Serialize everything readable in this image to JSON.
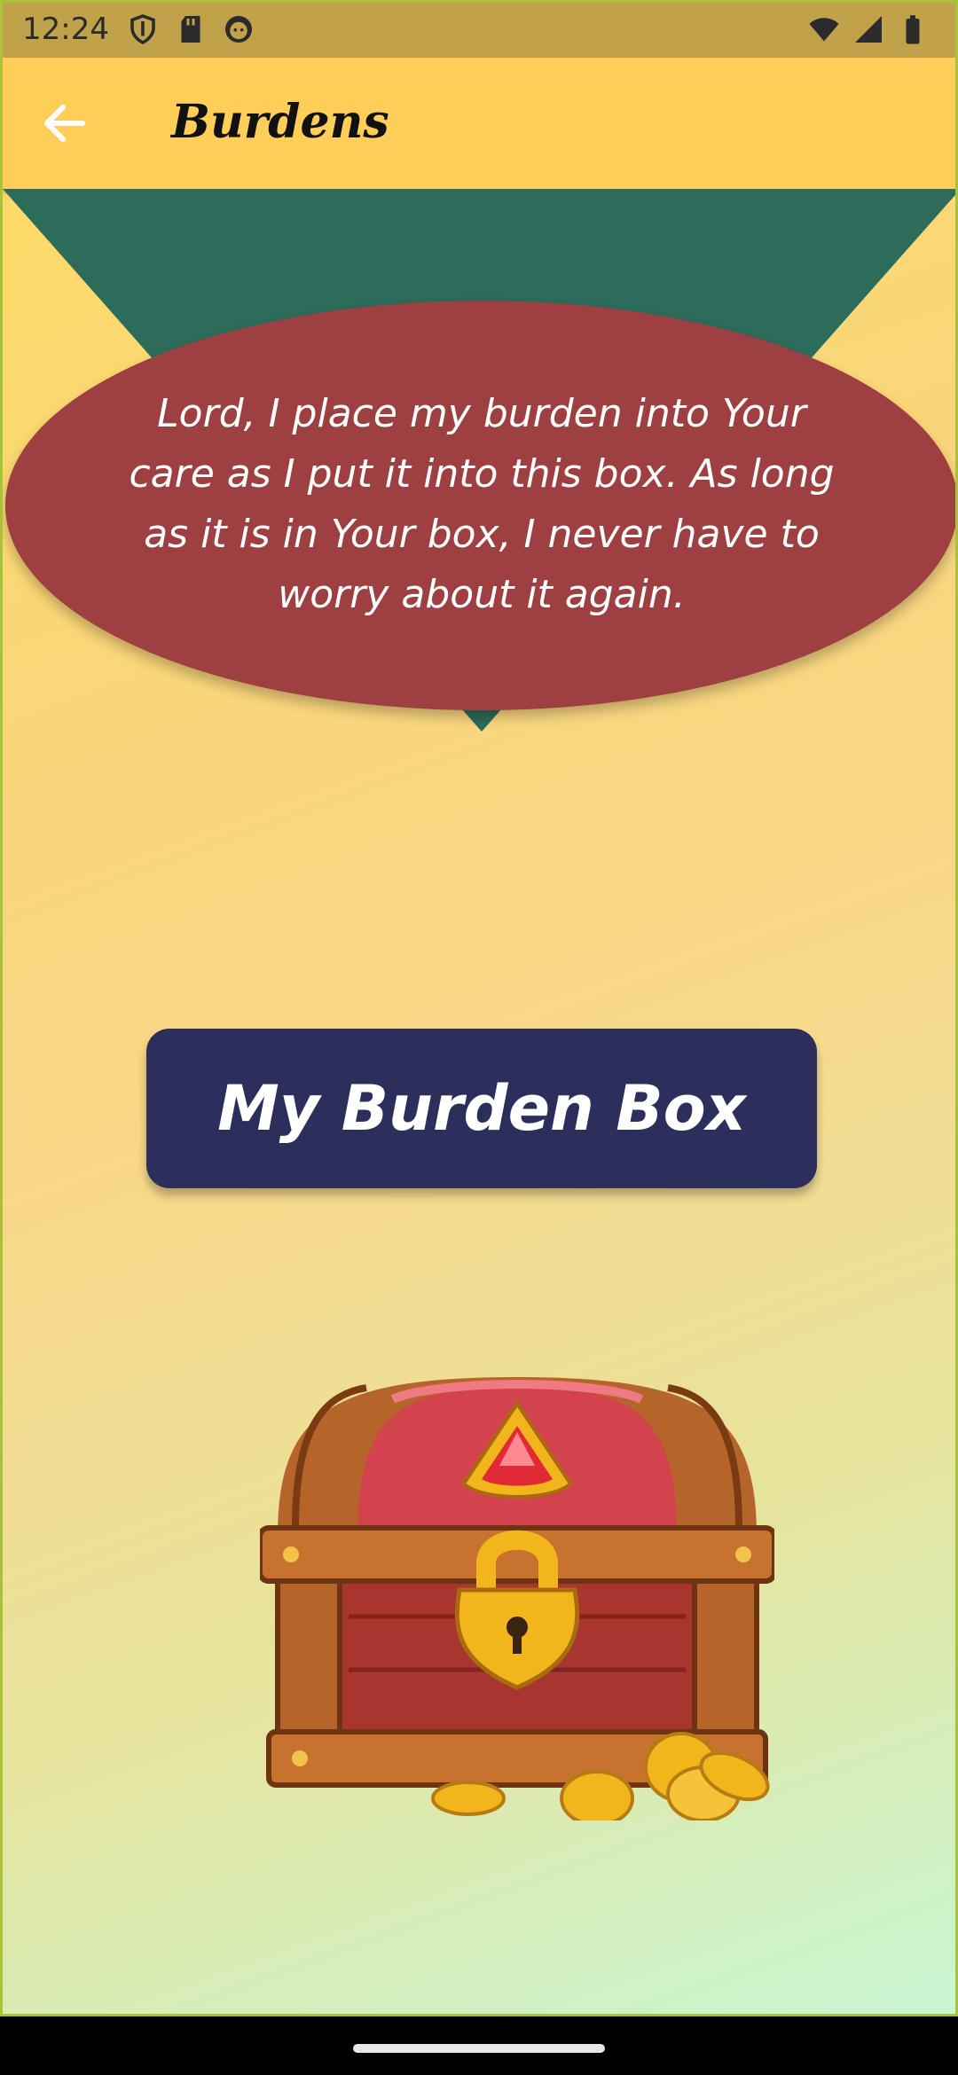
{
  "status_bar": {
    "time": "12:24",
    "left_icons": [
      "shield-icon",
      "sd-card-icon",
      "face-icon"
    ],
    "right_icons": [
      "wifi-icon",
      "signal-icon",
      "battery-icon"
    ]
  },
  "app_bar": {
    "title": "Burdens",
    "back_icon": "arrow-back-icon"
  },
  "prayer": {
    "text": "Lord, I place my burden into Your care as I put it into this box. As long as it is in Your box, I never have to worry about it again."
  },
  "burden_box_button": {
    "label": "My Burden Box"
  },
  "chest_image": "treasure-chest-icon",
  "colors": {
    "app_bar": "#ffce58",
    "status_bar": "#c0a24b",
    "triangle": "#2d6b5a",
    "bubble": "#9e3f41",
    "button": "#2c2f5c"
  }
}
